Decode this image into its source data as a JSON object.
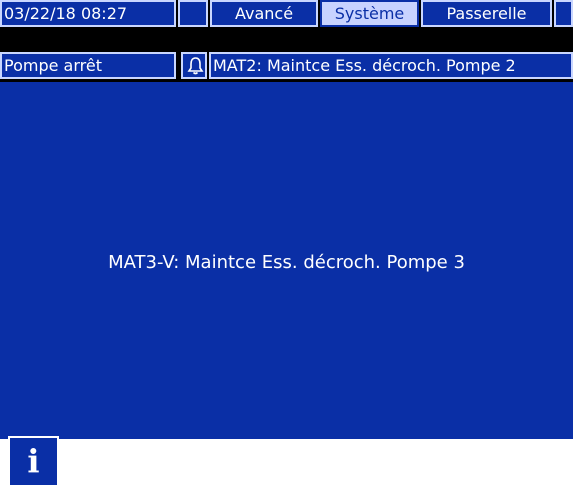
{
  "header": {
    "datetime": "03/22/18 08:27",
    "tabs": [
      {
        "label": "Avancé",
        "selected": false
      },
      {
        "label": "Système",
        "selected": true
      },
      {
        "label": "Passerelle",
        "selected": false
      }
    ]
  },
  "status": {
    "pump_state": "Pompe arrêt",
    "alarm_message": "MAT2: Maintce Ess. décroch. Pompe 2",
    "bell_icon": "bell-icon"
  },
  "main": {
    "message": "MAT3-V: Maintce Ess. décroch. Pompe 3",
    "info_button_glyph": "i"
  },
  "colors": {
    "background": "#0a2fa6",
    "selected_tab_bg": "#c8d3ff",
    "text": "#ffffff",
    "border": "#000000"
  }
}
